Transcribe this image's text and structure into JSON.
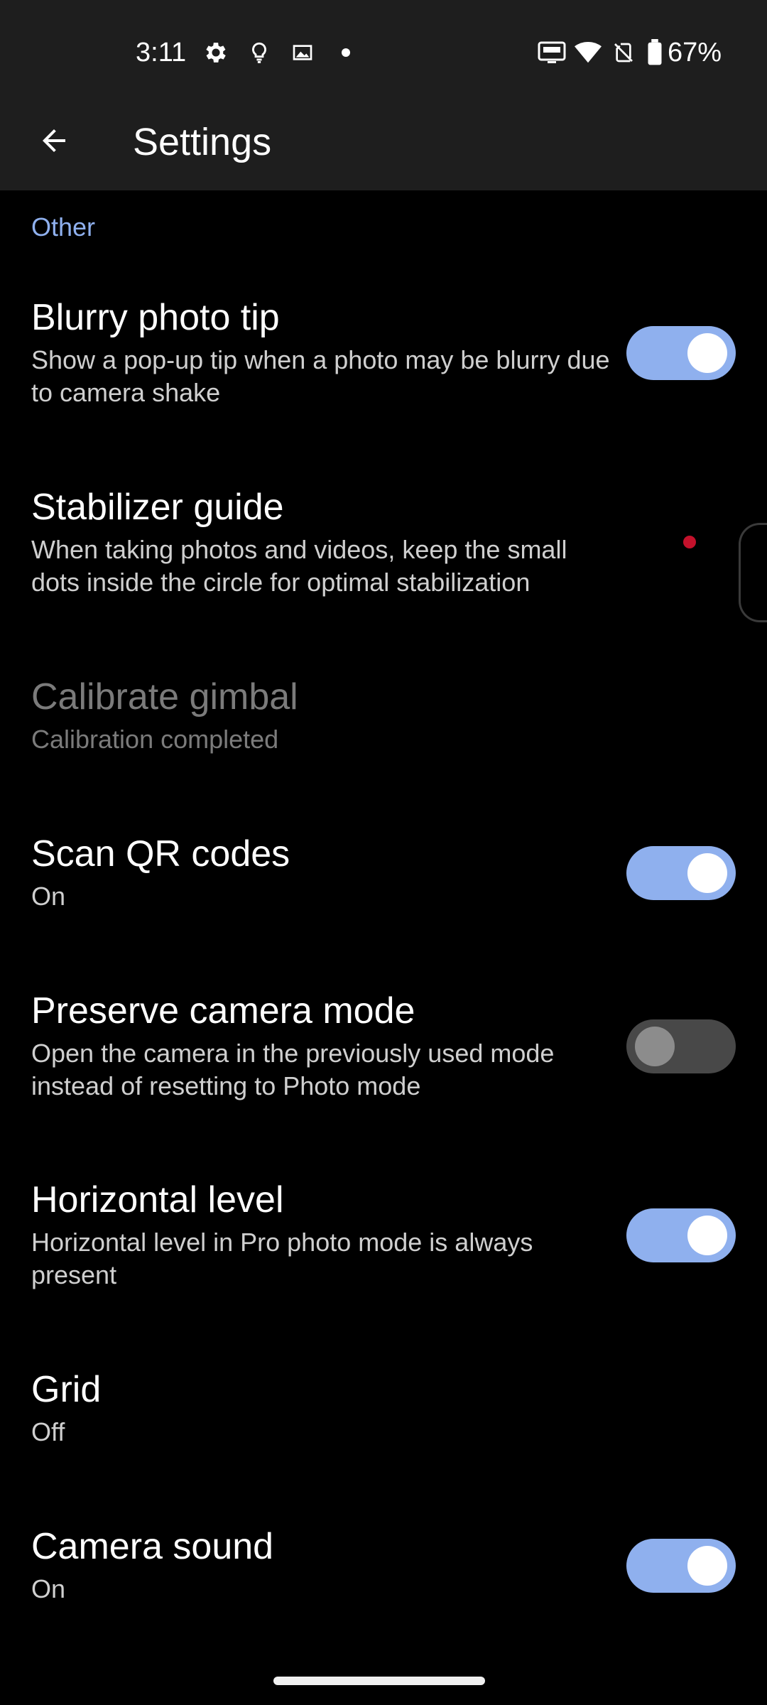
{
  "status_bar": {
    "time": "3:11",
    "battery_percent": "67%",
    "icons": [
      "settings-gear-icon",
      "lightbulb-icon",
      "image-icon",
      "notification-dot-icon",
      "auto-hz-icon",
      "wifi-icon",
      "no-sim-icon",
      "battery-icon"
    ]
  },
  "app_bar": {
    "title": "Settings",
    "back_icon": "arrow-left-icon"
  },
  "section": {
    "header": "Other"
  },
  "settings": [
    {
      "title": "Blurry photo tip",
      "summary": "Show a pop-up tip when a photo may be blurry due to camera shake",
      "toggle": "on"
    },
    {
      "title": "Stabilizer guide",
      "summary": "When taking photos and videos, keep the small dots inside the circle for optimal stabilization",
      "toggle": null
    },
    {
      "title": "Calibrate gimbal",
      "summary": "Calibration completed",
      "toggle": null,
      "enabled": false
    },
    {
      "title": "Scan QR codes",
      "summary": "On",
      "toggle": "on"
    },
    {
      "title": "Preserve camera mode",
      "summary": "Open the camera in the previously used mode instead of resetting to Photo mode",
      "toggle": "off"
    },
    {
      "title": "Horizontal level",
      "summary": "Horizontal level in Pro photo mode is always present",
      "toggle": "on"
    },
    {
      "title": "Grid",
      "summary": "Off",
      "toggle": null
    },
    {
      "title": "Camera sound",
      "summary": "On",
      "toggle": "on"
    }
  ],
  "colors": {
    "accent": "#8fb0ee",
    "background": "#000000",
    "bar_background": "#1e1e1e",
    "toggle_off": "#484848",
    "indicator_dot": "#c3112b"
  }
}
